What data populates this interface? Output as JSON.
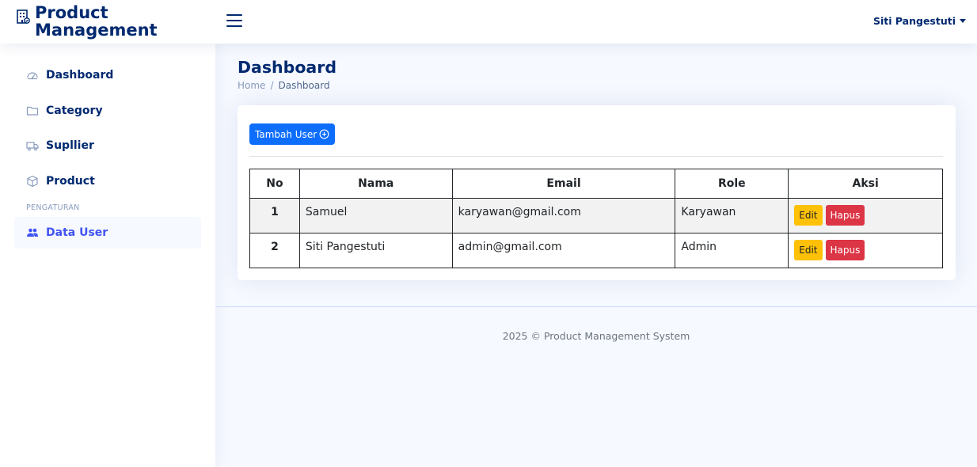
{
  "header": {
    "brand": "Product Management",
    "brand_line1": "Product",
    "brand_line2": "Management",
    "user_name": "Siti Pangestuti"
  },
  "sidebar": {
    "items": [
      {
        "label": "Dashboard",
        "icon": "speedometer-icon"
      },
      {
        "label": "Category",
        "icon": "folder-icon"
      },
      {
        "label": "Supllier",
        "icon": "truck-icon"
      },
      {
        "label": "Product",
        "icon": "box-icon"
      }
    ],
    "heading": "PENGATURAN",
    "settings_items": [
      {
        "label": "Data User",
        "icon": "people-icon",
        "active": true
      }
    ]
  },
  "page": {
    "title": "Dashboard",
    "breadcrumb": [
      "Home",
      "Dashboard"
    ],
    "breadcrumb_sep": "/"
  },
  "card": {
    "add_button_label": "Tambah User",
    "table": {
      "columns": [
        "No",
        "Nama",
        "Email",
        "Role",
        "Aksi"
      ],
      "rows": [
        {
          "no": "1",
          "nama": "Samuel",
          "email": "karyawan@gmail.com",
          "role": "Karyawan"
        },
        {
          "no": "2",
          "nama": "Siti Pangestuti",
          "email": "admin@gmail.com",
          "role": "Admin"
        }
      ],
      "edit_label": "Edit",
      "delete_label": "Hapus"
    }
  },
  "footer": {
    "text": "2025 © Product Management System"
  },
  "colors": {
    "brand": "#012970",
    "primary": "#0d6efd",
    "warning": "#ffc107",
    "danger": "#dc3545",
    "background": "#f6f9ff"
  }
}
